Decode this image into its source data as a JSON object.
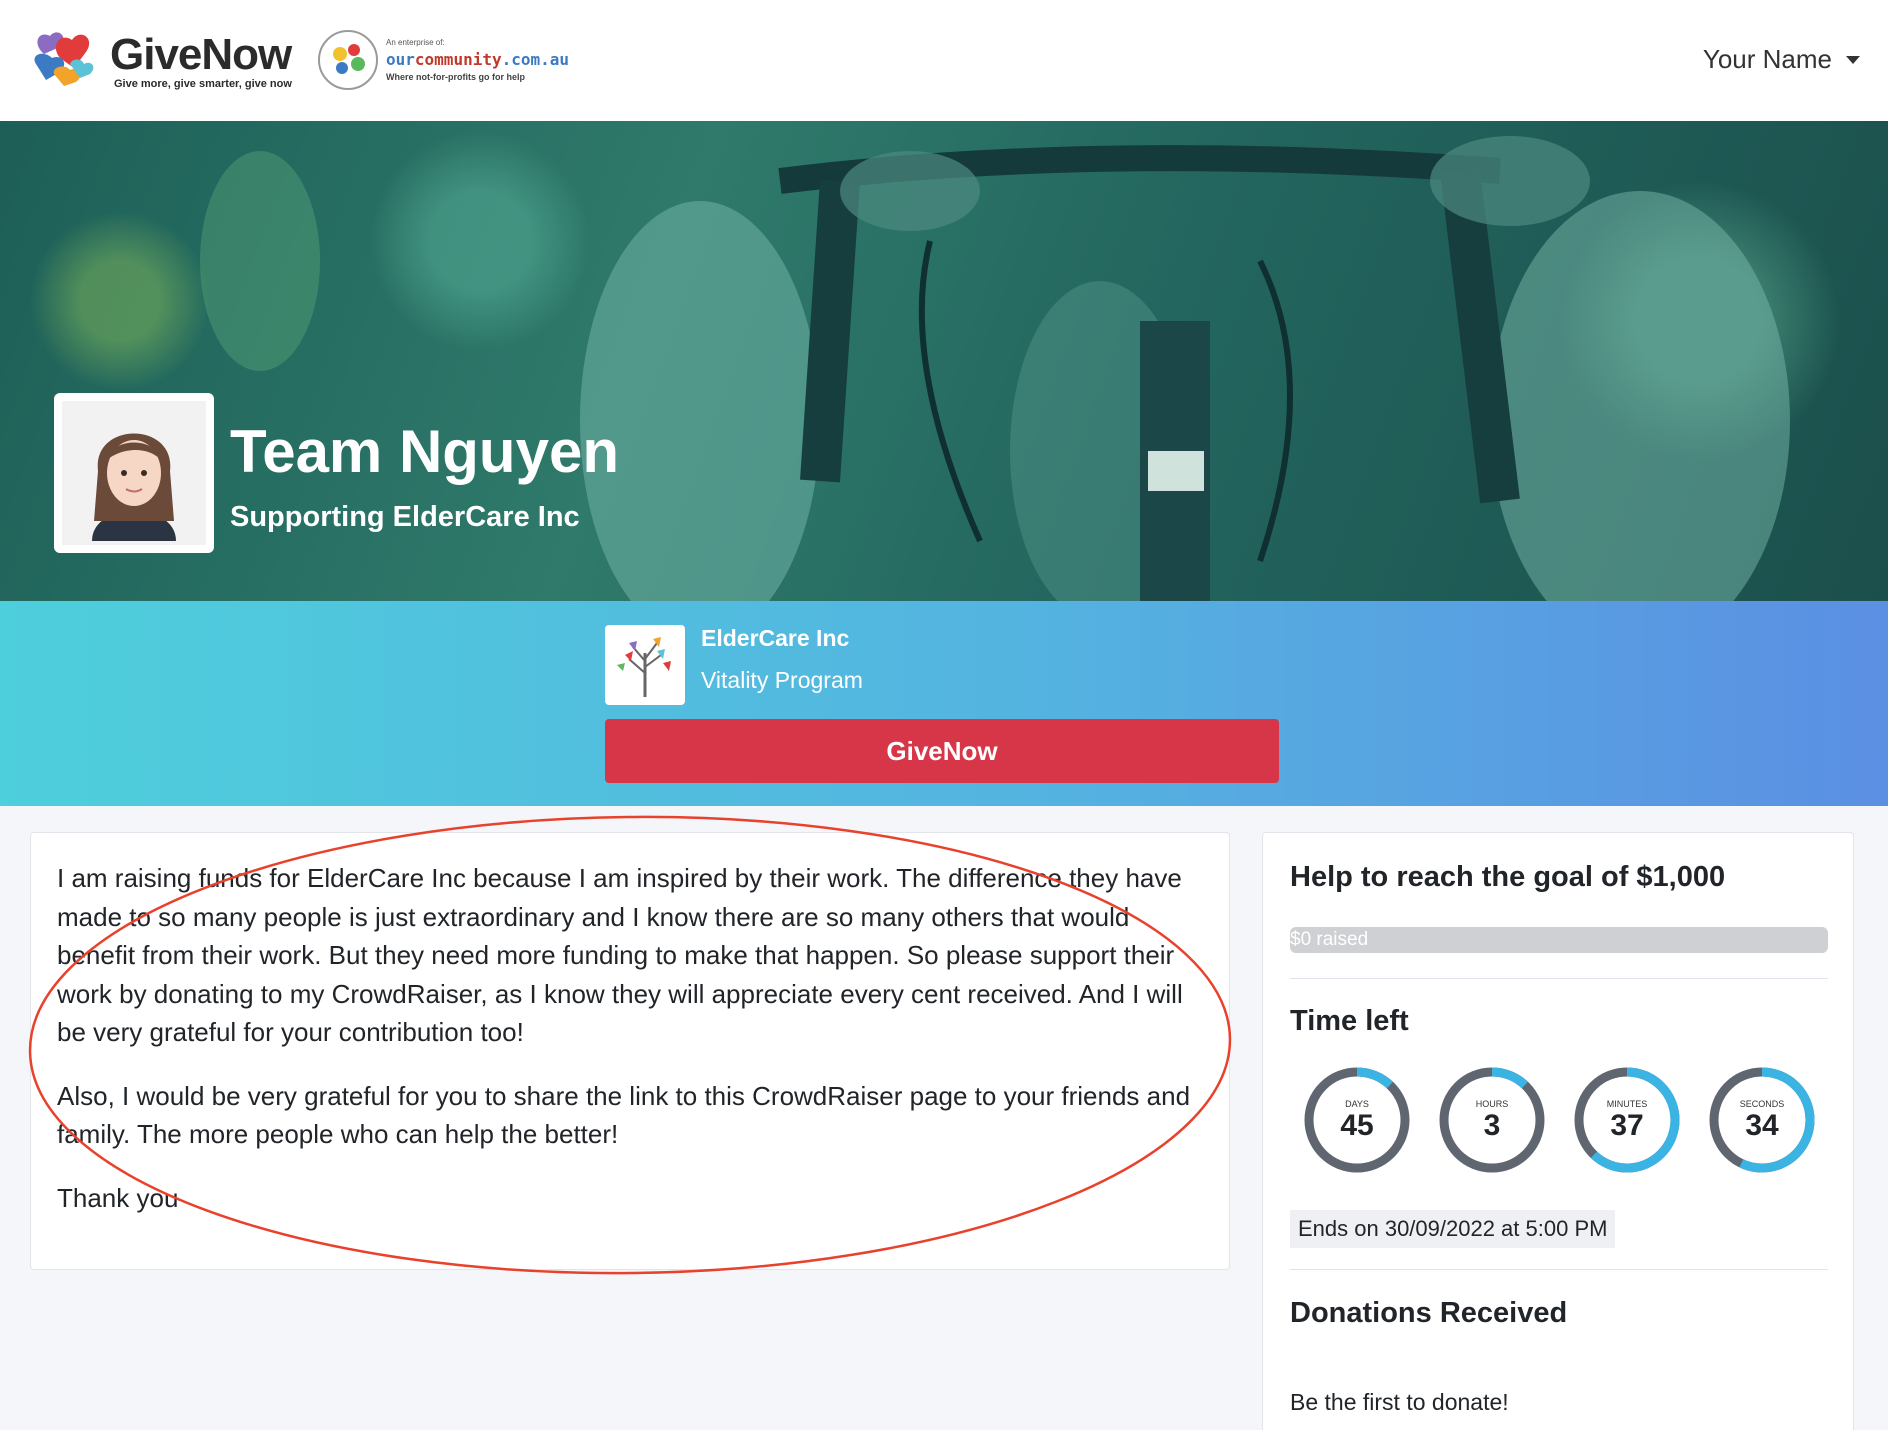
{
  "header": {
    "logo_name": "GiveNow",
    "logo_tagline": "Give more, give smarter, give now",
    "partner_small": "An enterprise of:",
    "partner_name_a": "our",
    "partner_name_b": "community",
    "partner_name_c": ".com.au",
    "partner_tagline": "Where not-for-profits go for help",
    "user_name": "Your Name"
  },
  "hero": {
    "title": "Team Nguyen",
    "subtitle": "Supporting ElderCare Inc"
  },
  "org": {
    "name": "ElderCare Inc",
    "program": "Vitality Program",
    "give_button": "GiveNow"
  },
  "story": {
    "paragraphs": [
      "I am raising funds for ElderCare Inc because I am inspired by their work. The difference they have made to so many people is just extraordinary and I know there are so many others that would benefit from their work. But they need more funding to make that happen. So please support their work by donating to my CrowdRaiser, as I know they will appreciate every cent received. And I will be very grateful for your contribution too!",
      "Also, I would be very grateful for you to share the link to this CrowdRaiser page to your friends and family. The more people who can help the better!",
      "Thank you"
    ]
  },
  "sidebar": {
    "goal_heading": "Help to reach the goal of $1,000",
    "raised_label": "$0 raised",
    "raised_fraction": 0,
    "time_heading": "Time left",
    "timers": [
      {
        "label": "DAYS",
        "value": "45",
        "fraction": 0.12
      },
      {
        "label": "HOURS",
        "value": "3",
        "fraction": 0.12
      },
      {
        "label": "MINUTES",
        "value": "37",
        "fraction": 0.62
      },
      {
        "label": "SECONDS",
        "value": "34",
        "fraction": 0.57
      }
    ],
    "ends_text": "Ends on 30/09/2022 at 5:00 PM",
    "donations_heading": "Donations Received",
    "donations_empty": "Be the first to donate!"
  },
  "colors": {
    "accent_red": "#d63647",
    "timer_blue": "#3bb3e3",
    "timer_gray": "#5f6670",
    "annotation_red": "#e8412c"
  }
}
